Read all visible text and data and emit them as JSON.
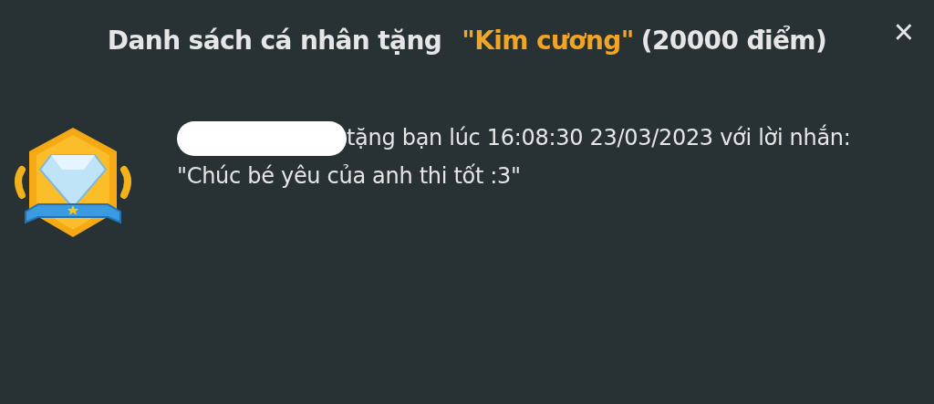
{
  "dialog": {
    "title": {
      "prefix": "Danh sách cá nhân tặng",
      "gift_name": "\"Kim cương\"",
      "points": "(20000 điểm)"
    },
    "close": "×",
    "gifts": [
      {
        "kind": "badge",
        "sender_hidden": true,
        "message": "tặng bạn lúc 16:08:30 23/03/2023 với lời nhắn: \"Chúc bé yêu của anh thi tốt :3\""
      }
    ]
  }
}
